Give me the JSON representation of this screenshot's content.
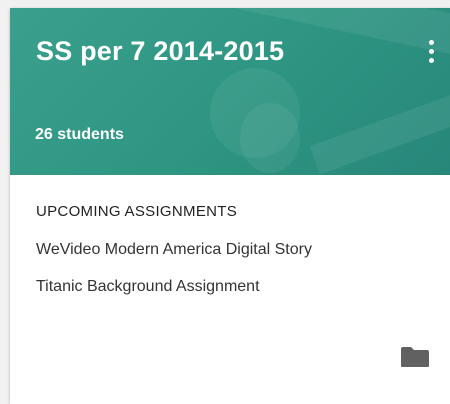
{
  "card": {
    "title": "SS per 7 2014-2015",
    "students": "26 students",
    "header_color": "#2e9582",
    "upcoming": {
      "label": "UPCOMING ASSIGNMENTS",
      "items": [
        {
          "title": "WeVideo Modern America Digital Story"
        },
        {
          "title": "Titanic Background Assignment"
        }
      ]
    },
    "icons": {
      "menu": "more-vertical-icon",
      "folder": "folder-icon"
    }
  }
}
